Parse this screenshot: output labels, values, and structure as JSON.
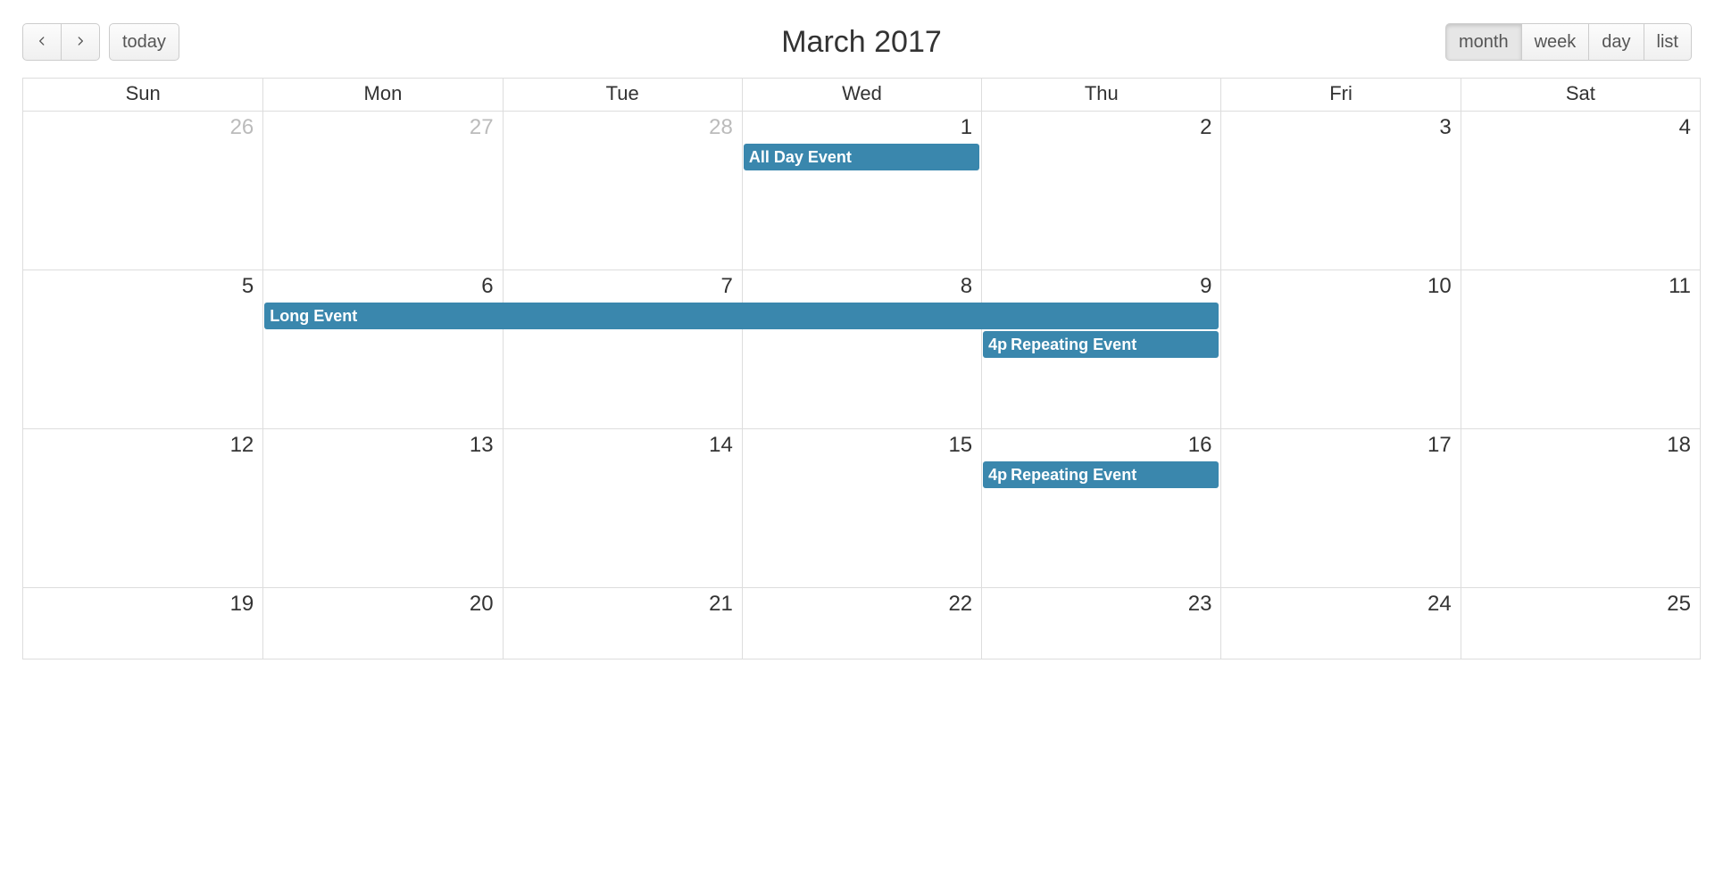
{
  "title": "March 2017",
  "buttons": {
    "today": "today",
    "views": {
      "month": "month",
      "week": "week",
      "day": "day",
      "list": "list"
    }
  },
  "active_view": "month",
  "day_headers": [
    "Sun",
    "Mon",
    "Tue",
    "Wed",
    "Thu",
    "Fri",
    "Sat"
  ],
  "weeks": [
    {
      "days": [
        {
          "n": "26",
          "other": true
        },
        {
          "n": "27",
          "other": true
        },
        {
          "n": "28",
          "other": true
        },
        {
          "n": "1"
        },
        {
          "n": "2"
        },
        {
          "n": "3"
        },
        {
          "n": "4"
        }
      ],
      "events": [
        {
          "title": "All Day Event",
          "time": "",
          "col": 4,
          "span": 1,
          "row": 1
        }
      ]
    },
    {
      "days": [
        {
          "n": "5"
        },
        {
          "n": "6"
        },
        {
          "n": "7"
        },
        {
          "n": "8"
        },
        {
          "n": "9"
        },
        {
          "n": "10"
        },
        {
          "n": "11"
        }
      ],
      "events": [
        {
          "title": "Long Event",
          "time": "",
          "col": 2,
          "span": 4,
          "row": 1
        },
        {
          "title": "Repeating Event",
          "time": "4p",
          "col": 5,
          "span": 1,
          "row": 2
        }
      ]
    },
    {
      "days": [
        {
          "n": "12"
        },
        {
          "n": "13"
        },
        {
          "n": "14"
        },
        {
          "n": "15"
        },
        {
          "n": "16"
        },
        {
          "n": "17"
        },
        {
          "n": "18"
        }
      ],
      "events": [
        {
          "title": "Repeating Event",
          "time": "4p",
          "col": 5,
          "span": 1,
          "row": 1
        }
      ]
    },
    {
      "days": [
        {
          "n": "19"
        },
        {
          "n": "20"
        },
        {
          "n": "21"
        },
        {
          "n": "22"
        },
        {
          "n": "23"
        },
        {
          "n": "24"
        },
        {
          "n": "25"
        }
      ],
      "events": [],
      "partial": true
    }
  ],
  "colors": {
    "event_bg": "#3a87ad"
  }
}
